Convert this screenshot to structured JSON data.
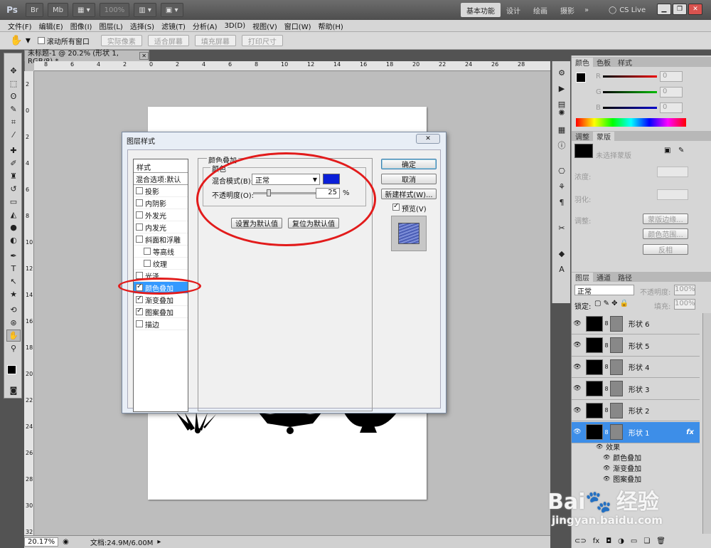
{
  "app": {
    "logo": "Ps",
    "zoom": "100%",
    "workspaces": [
      "基本功能",
      "设计",
      "绘画",
      "摄影"
    ],
    "more": "»",
    "cs_live": "CS Live"
  },
  "menu": [
    "文件(F)",
    "编辑(E)",
    "图像(I)",
    "图层(L)",
    "选择(S)",
    "滤镜(T)",
    "分析(A)",
    "3D(D)",
    "视图(V)",
    "窗口(W)",
    "帮助(H)"
  ],
  "options": {
    "scroll_all_label": "滚动所有窗口",
    "buttons": [
      "实际像素",
      "适合屏幕",
      "填充屏幕",
      "打印尺寸"
    ]
  },
  "document": {
    "tab_title": "未标题-1 @ 20.2% (形状 1, RGB/8) *",
    "ruler_h": [
      "8",
      "6",
      "4",
      "2",
      "0",
      "2",
      "4",
      "6",
      "8",
      "10",
      "12",
      "14",
      "16",
      "18",
      "20",
      "22",
      "24",
      "26",
      "28"
    ],
    "ruler_v": [
      "2",
      "0",
      "2",
      "4",
      "6",
      "8",
      "10",
      "12",
      "14",
      "16",
      "18",
      "20",
      "22",
      "24",
      "26",
      "28",
      "30",
      "32"
    ],
    "status_zoom": "20.17%",
    "status_doc": "文档:24.9M/6.00M"
  },
  "dialog": {
    "title": "图层样式",
    "styles_header": "样式",
    "blend_options": "混合选项:默认",
    "items": [
      {
        "label": "投影",
        "checked": false,
        "sub": false
      },
      {
        "label": "内阴影",
        "checked": false,
        "sub": false
      },
      {
        "label": "外发光",
        "checked": false,
        "sub": false
      },
      {
        "label": "内发光",
        "checked": false,
        "sub": false
      },
      {
        "label": "斜面和浮雕",
        "checked": false,
        "sub": false
      },
      {
        "label": "等高线",
        "checked": false,
        "sub": true
      },
      {
        "label": "纹理",
        "checked": false,
        "sub": true
      },
      {
        "label": "光泽",
        "checked": false,
        "sub": false
      },
      {
        "label": "颜色叠加",
        "checked": true,
        "sub": false,
        "selected": true
      },
      {
        "label": "渐变叠加",
        "checked": true,
        "sub": false
      },
      {
        "label": "图案叠加",
        "checked": true,
        "sub": false
      },
      {
        "label": "描边",
        "checked": false,
        "sub": false
      }
    ],
    "group_title": "颜色叠加",
    "subgroup_title": "颜色",
    "blend_mode_label": "混合模式(B):",
    "blend_mode_value": "正常",
    "overlay_color": "#0a1fd8",
    "opacity_label": "不透明度(O):",
    "opacity_value": "25",
    "opacity_unit": "%",
    "set_default": "设置为默认值",
    "reset_default": "复位为默认值",
    "ok": "确定",
    "cancel": "取消",
    "new_style": "新建样式(W)...",
    "preview": "预览(V)"
  },
  "color_panel": {
    "tabs": [
      "颜色",
      "色板",
      "样式"
    ],
    "channels": [
      {
        "label": "R",
        "value": "0"
      },
      {
        "label": "G",
        "value": "0"
      },
      {
        "label": "B",
        "value": "0"
      }
    ]
  },
  "adjust_panel": {
    "tabs": [
      "调整",
      "蒙版"
    ],
    "hint": "未选择蒙版",
    "density": "浓度:",
    "feather": "羽化:",
    "refine": "调整:",
    "mask_edge": "蒙版边缘...",
    "color_range": "颜色范围...",
    "invert": "反相"
  },
  "layers_panel": {
    "tabs": [
      "图层",
      "通道",
      "路径"
    ],
    "blend": "正常",
    "opacity_label": "不透明度:",
    "opacity": "100%",
    "lock_label": "锁定:",
    "fill_label": "填充:",
    "fill": "100%",
    "layers": [
      {
        "name": "形状 6",
        "selected": false,
        "fx": false
      },
      {
        "name": "形状 5",
        "selected": false,
        "fx": false
      },
      {
        "name": "形状 4",
        "selected": false,
        "fx": false
      },
      {
        "name": "形状 3",
        "selected": false,
        "fx": false
      },
      {
        "name": "形状 2",
        "selected": false,
        "fx": false
      },
      {
        "name": "形状 1",
        "selected": true,
        "fx": true
      }
    ],
    "effects_label": "效果",
    "effects": [
      "颜色叠加",
      "渐变叠加",
      "图案叠加"
    ],
    "fx": "fx"
  },
  "watermark": {
    "line1": "Bai",
    "line2": "经验",
    "line3": "jingyan.baidu.com"
  }
}
